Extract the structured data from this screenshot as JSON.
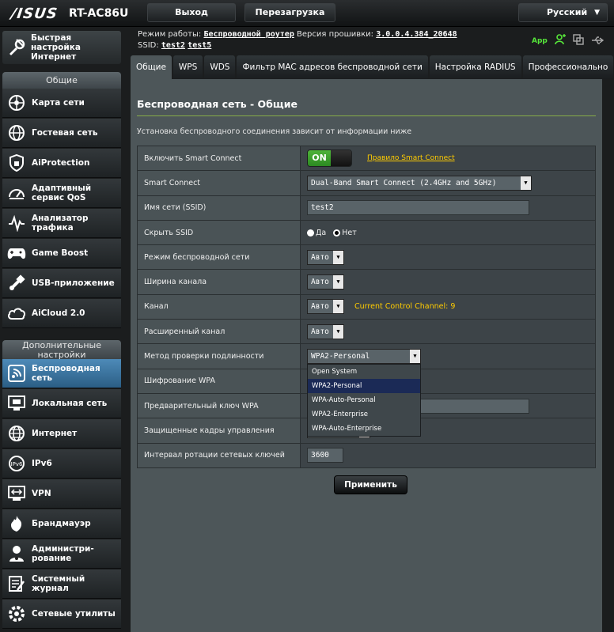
{
  "header": {
    "brand": "/ISUS",
    "model": "RT-AC86U",
    "logout_label": "Выход",
    "reboot_label": "Перезагрузка",
    "language": "Русский",
    "mode_label": "Режим работы:",
    "mode_value": "Беспроводной роутер",
    "firmware_label": "Версия прошивки:",
    "firmware_value": "3.0.0.4.384_20648",
    "ssid_label": "SSID:",
    "ssid_1": "test2",
    "ssid_2": "test5",
    "app_label": "App"
  },
  "sidebar": {
    "qis_label": "Быстрая настройка Интернет",
    "general_title": "Общие",
    "general_items": [
      {
        "label": "Карта сети",
        "icon": "network-map-icon"
      },
      {
        "label": "Гостевая сеть",
        "icon": "guest-network-icon"
      },
      {
        "label": "AiProtection",
        "icon": "shield-icon"
      },
      {
        "label": "Адаптивный сервис QoS",
        "icon": "qos-gauge-icon"
      },
      {
        "label": "Анализатор трафика",
        "icon": "traffic-analyzer-icon"
      },
      {
        "label": "Game Boost",
        "icon": "gamepad-icon"
      },
      {
        "label": "USB-приложение",
        "icon": "usb-app-icon"
      },
      {
        "label": "AiCloud 2.0",
        "icon": "cloud-icon"
      }
    ],
    "advanced_title": "Дополнительные настройки",
    "advanced_items": [
      {
        "label": "Беспроводная сеть",
        "icon": "wireless-icon",
        "active": true
      },
      {
        "label": "Локальная сеть",
        "icon": "lan-icon"
      },
      {
        "label": "Интернет",
        "icon": "globe-icon"
      },
      {
        "label": "IPv6",
        "icon": "ipv6-icon"
      },
      {
        "label": "VPN",
        "icon": "vpn-icon"
      },
      {
        "label": "Брандмауэр",
        "icon": "firewall-icon"
      },
      {
        "label": "Администри-рование",
        "icon": "admin-icon"
      },
      {
        "label": "Системный журнал",
        "icon": "system-log-icon"
      },
      {
        "label": "Сетевые утилиты",
        "icon": "network-tools-icon"
      }
    ]
  },
  "tabs": [
    "Общие",
    "WPS",
    "WDS",
    "Фильтр MAC адресов беспроводной сети",
    "Настройка RADIUS",
    "Профессионально"
  ],
  "main": {
    "title": "Беспроводная сеть - Общие",
    "description": "Установка беспроводного соединения зависит от информации ниже",
    "rows": {
      "smart_connect_enable": {
        "label": "Включить Smart Connect",
        "toggle": "ON",
        "link": "Правило Smart Connect"
      },
      "smart_connect": {
        "label": "Smart Connect",
        "value": "Dual-Band Smart Connect (2.4GHz and 5GHz)"
      },
      "ssid": {
        "label": "Имя сети (SSID)",
        "value": "test2"
      },
      "hide_ssid": {
        "label": "Скрыть SSID",
        "yes": "Да",
        "no": "Нет",
        "selected": "no"
      },
      "wireless_mode": {
        "label": "Режим беспроводной сети",
        "value": "Авто"
      },
      "channel_width": {
        "label": "Ширина канала",
        "value": "Авто"
      },
      "channel": {
        "label": "Канал",
        "value": "Авто",
        "note": "Current Control Channel: 9"
      },
      "ext_channel": {
        "label": "Расширенный канал",
        "value": "Авто"
      },
      "auth_method": {
        "label": "Метод проверки подлинности",
        "value": "WPA2-Personal"
      },
      "wpa_encryption": {
        "label": "Шифрование WPA"
      },
      "psk": {
        "label": "Предварительный ключ WPA"
      },
      "pmf": {
        "label": "Защищенные кадры управления"
      },
      "key_rotation": {
        "label": "Интервал ротации сетевых ключей",
        "value": "3600"
      }
    },
    "auth_options": [
      "Open System",
      "WPA2-Personal",
      "WPA-Auto-Personal",
      "WPA2-Enterprise",
      "WPA-Auto-Enterprise"
    ],
    "auth_selected_index": 1,
    "apply_label": "Применить"
  },
  "colors": {
    "active_menu": "#3f7aa6",
    "panel": "#4d5659",
    "accent_rule": "#87ad48",
    "toggle_on": "#3d9e2e",
    "link_yellow": "#ffcc00",
    "dropdown_selected": "#1b2a56"
  }
}
